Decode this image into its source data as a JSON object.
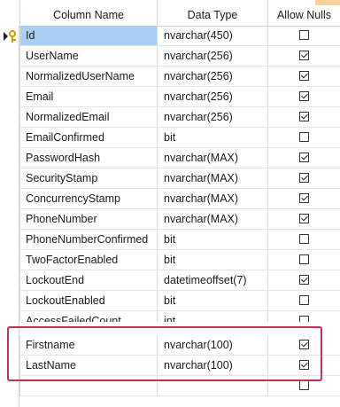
{
  "headers": {
    "column_name": "Column Name",
    "data_type": "Data Type",
    "allow_nulls": "Allow Nulls"
  },
  "rows": [
    {
      "name": "Id",
      "type": "nvarchar(450)",
      "nullable": false,
      "key": true,
      "selected": true
    },
    {
      "name": "UserName",
      "type": "nvarchar(256)",
      "nullable": true
    },
    {
      "name": "NormalizedUserName",
      "type": "nvarchar(256)",
      "nullable": true
    },
    {
      "name": "Email",
      "type": "nvarchar(256)",
      "nullable": true
    },
    {
      "name": "NormalizedEmail",
      "type": "nvarchar(256)",
      "nullable": true
    },
    {
      "name": "EmailConfirmed",
      "type": "bit",
      "nullable": false
    },
    {
      "name": "PasswordHash",
      "type": "nvarchar(MAX)",
      "nullable": true
    },
    {
      "name": "SecurityStamp",
      "type": "nvarchar(MAX)",
      "nullable": true
    },
    {
      "name": "ConcurrencyStamp",
      "type": "nvarchar(MAX)",
      "nullable": true
    },
    {
      "name": "PhoneNumber",
      "type": "nvarchar(MAX)",
      "nullable": true
    },
    {
      "name": "PhoneNumberConfirmed",
      "type": "bit",
      "nullable": false
    },
    {
      "name": "TwoFactorEnabled",
      "type": "bit",
      "nullable": false
    },
    {
      "name": "LockoutEnd",
      "type": "datetimeoffset(7)",
      "nullable": true
    },
    {
      "name": "LockoutEnabled",
      "type": "bit",
      "nullable": false
    },
    {
      "name": "AccessFailedCount",
      "type": "int",
      "nullable": false,
      "partial": true
    },
    {
      "name": "Firstname",
      "type": "nvarchar(100)",
      "nullable": true,
      "highlighted": true
    },
    {
      "name": "LastName",
      "type": "nvarchar(100)",
      "nullable": true,
      "highlighted": true
    },
    {
      "name": "",
      "type": "",
      "nullable": false,
      "empty": true
    }
  ],
  "icons": {
    "primary_key": "key-icon",
    "row_pointer": "arrow-pointer-icon"
  },
  "colors": {
    "selection": "#a9d0f2",
    "highlight_border": "#c0314f"
  }
}
